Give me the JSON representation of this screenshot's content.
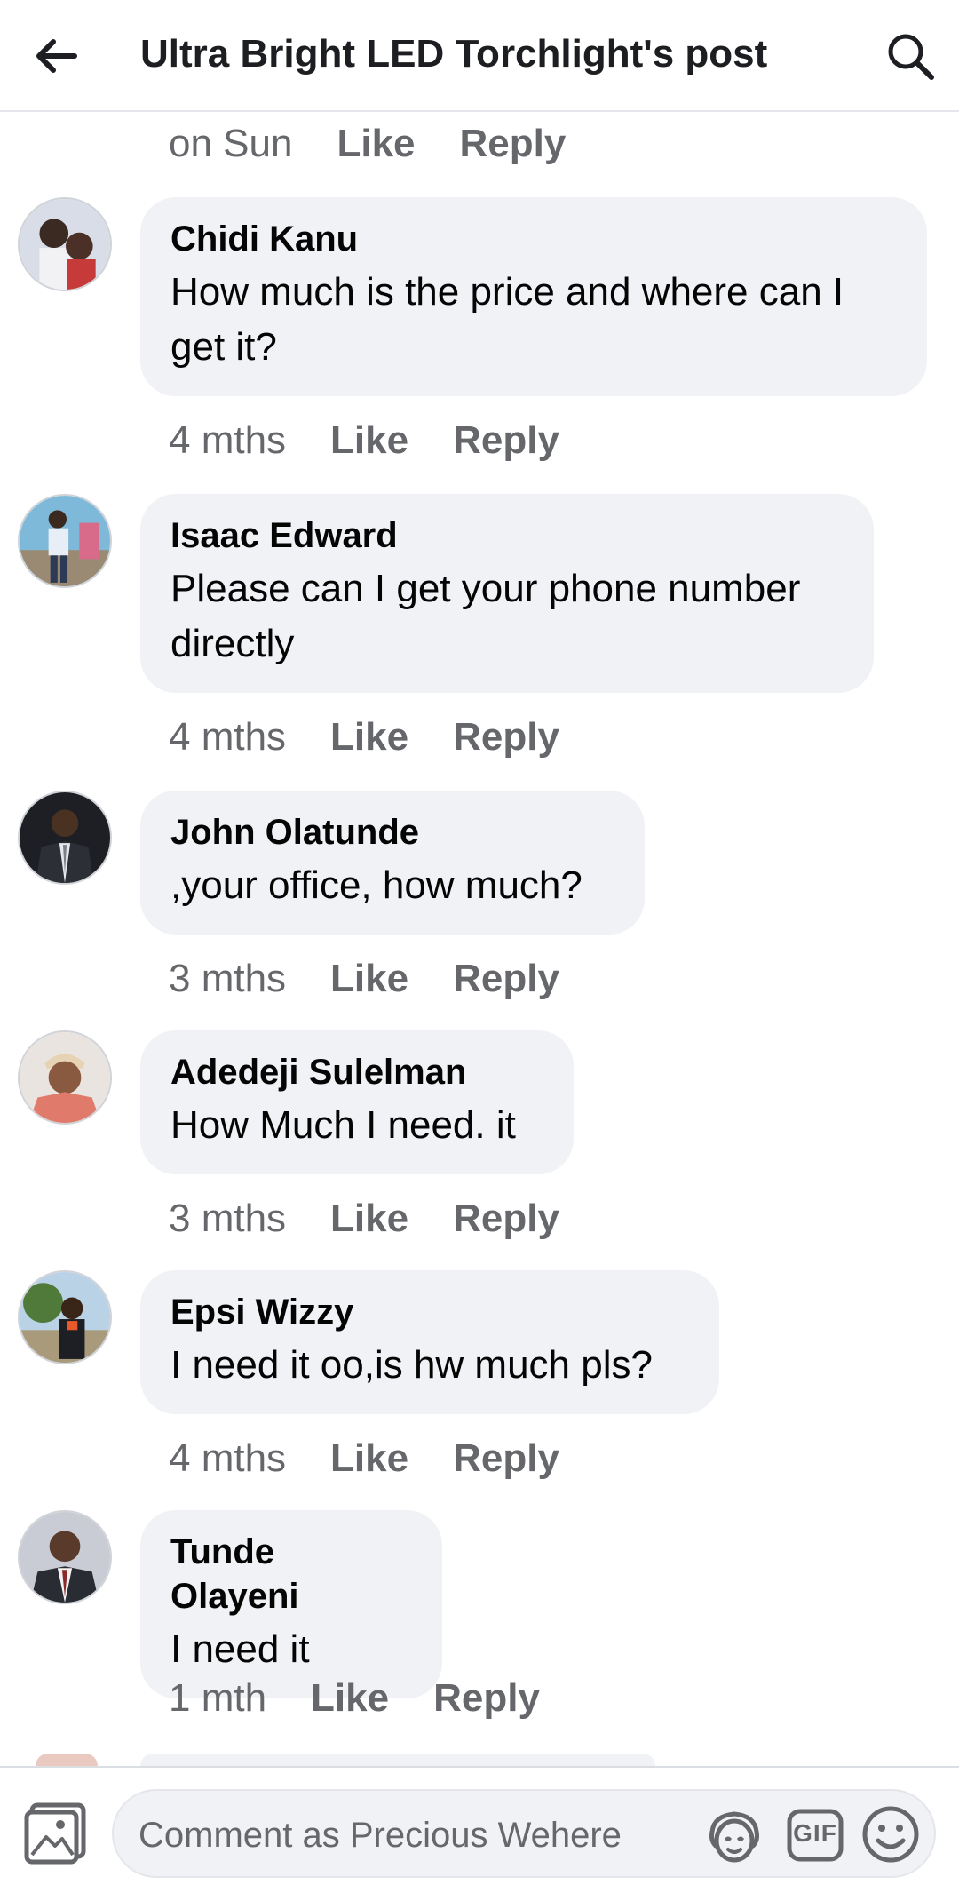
{
  "header": {
    "title": "Ultra Bright LED Torchlight's post",
    "back_icon": "arrow-left-icon",
    "search_icon": "search-icon"
  },
  "top_partial": {
    "time": "on Sun",
    "like_label": "Like",
    "reply_label": "Reply"
  },
  "comments": [
    {
      "name": "Chidi Kanu",
      "text_lines": [
        "How much is the price and where can I",
        "get it?"
      ],
      "time": "4 mths",
      "like_label": "Like",
      "reply_label": "Reply"
    },
    {
      "name": "Isaac Edward",
      "text_lines": [
        "Please can I get your phone number",
        "directly"
      ],
      "time": "4 mths",
      "like_label": "Like",
      "reply_label": "Reply"
    },
    {
      "name": "John Olatunde",
      "text_lines": [
        ",your office, how much?"
      ],
      "time": "3 mths",
      "like_label": "Like",
      "reply_label": "Reply"
    },
    {
      "name": "Adedeji Sulelman",
      "text_lines": [
        "How Much I need. it"
      ],
      "time": "3 mths",
      "like_label": "Like",
      "reply_label": "Reply"
    },
    {
      "name": "Epsi Wizzy",
      "text_lines": [
        "I need it oo,is hw much pls?"
      ],
      "time": "4 mths",
      "like_label": "Like",
      "reply_label": "Reply"
    },
    {
      "name": "Tunde Olayeni",
      "text_lines": [
        "I need it"
      ],
      "time": "1 mth",
      "like_label": "Like",
      "reply_label": "Reply"
    }
  ],
  "composer": {
    "placeholder": "Comment as Precious Wehere",
    "gif_label": "GIF",
    "photo_icon": "photo-icon",
    "avatar_sticker_icon": "avatar-sticker-icon",
    "emoji_icon": "emoji-icon"
  },
  "colors": {
    "bubble_bg": "#f0f2f5",
    "meta_text": "#65676b",
    "title_text": "#1c1e21",
    "divider": "#e4e6eb"
  }
}
